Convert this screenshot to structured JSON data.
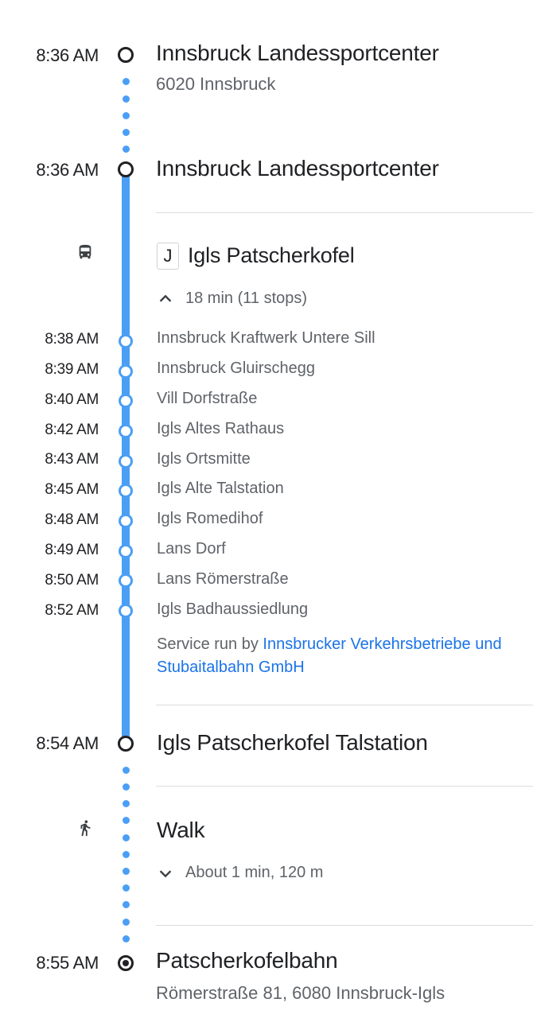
{
  "origin": {
    "time": "8:36 AM",
    "name": "Innsbruck Landessportcenter",
    "address": "6020 Innsbruck"
  },
  "transit": {
    "board_time": "8:36 AM",
    "board_stop": "Innsbruck Landessportcenter",
    "vehicle_icon": "bus-icon",
    "route_short": "J",
    "route_headsign": "Igls Patscherkofel",
    "stops_summary": "18 min (11 stops)",
    "intermediate_stops": [
      {
        "time": "8:38 AM",
        "name": "Innsbruck Kraftwerk Untere Sill"
      },
      {
        "time": "8:39 AM",
        "name": "Innsbruck Gluirschegg"
      },
      {
        "time": "8:40 AM",
        "name": "Vill Dorfstraße"
      },
      {
        "time": "8:42 AM",
        "name": "Igls Altes Rathaus"
      },
      {
        "time": "8:43 AM",
        "name": "Igls Ortsmitte"
      },
      {
        "time": "8:45 AM",
        "name": "Igls Alte Talstation"
      },
      {
        "time": "8:48 AM",
        "name": "Igls Romedihof"
      },
      {
        "time": "8:49 AM",
        "name": "Lans Dorf"
      },
      {
        "time": "8:50 AM",
        "name": "Lans Römerstraße"
      },
      {
        "time": "8:52 AM",
        "name": "Igls Badhaussiedlung"
      }
    ],
    "service_prefix": "Service run by ",
    "service_agency": "Innsbrucker Verkehrsbetriebe und Stubaitalbahn GmbH",
    "alight_time": "8:54 AM",
    "alight_stop": "Igls Patscherkofel Talstation"
  },
  "walk": {
    "icon": "walk-icon",
    "label": "Walk",
    "summary": "About 1 min, 120 m"
  },
  "destination": {
    "time": "8:55 AM",
    "name": "Patscherkofelbahn",
    "address": "Römerstraße 81, 6080 Innsbruck-Igls"
  },
  "colors": {
    "route_line": "#4a9ff5",
    "link": "#1a73e8",
    "text_primary": "#202124",
    "text_secondary": "#5f6368"
  }
}
